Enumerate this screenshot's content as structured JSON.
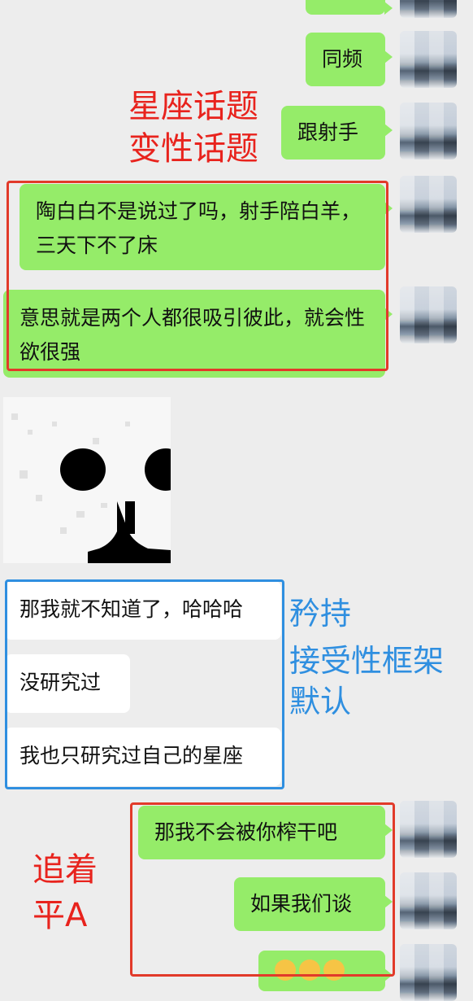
{
  "messages_right": [
    {
      "text": ""
    },
    {
      "text": "同频"
    },
    {
      "text": "跟射手"
    },
    {
      "text": "陶白白不是说过了吗，射手陪白羊，三天下不了床"
    },
    {
      "text": "意思就是两个人都很吸引彼此，就会性欲很强"
    },
    {
      "text": "那我不会被你榨干吧"
    },
    {
      "text": "如果我们谈"
    },
    {
      "text": ""
    }
  ],
  "messages_left": [
    {
      "text": "那我就不知道了，哈哈哈"
    },
    {
      "text": "没研究过"
    },
    {
      "text": "我也只研究过自己的星座"
    }
  ],
  "annotations": {
    "red_top_line1": "星座话题",
    "red_top_line2": "变性话题",
    "blue_line1": "矜持",
    "blue_line2": "接受性框架",
    "blue_line3": "默认",
    "red_bottom_line1": "追着",
    "red_bottom_line2": "平A"
  },
  "colors": {
    "background": "#ededed",
    "bubble_self": "#95ec69",
    "bubble_other": "#ffffff",
    "annotation_red": "#e8231d",
    "annotation_blue": "#2f8fe0"
  },
  "icons": [
    "avatar",
    "sticker-face"
  ]
}
